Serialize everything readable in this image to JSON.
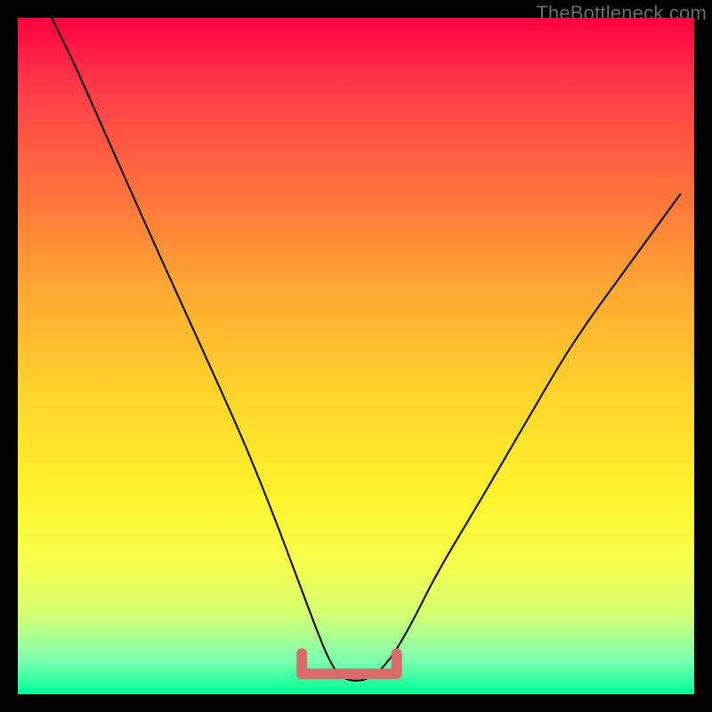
{
  "watermark": "TheBottleneck.com",
  "chart_data": {
    "type": "line",
    "title": "",
    "xlabel": "",
    "ylabel": "",
    "xlim": [
      0,
      100
    ],
    "ylim": [
      0,
      100
    ],
    "series": [
      {
        "name": "bottleneck-curve",
        "x": [
          5,
          8,
          12,
          16,
          20,
          25,
          30,
          34,
          38,
          41,
          44,
          46,
          48,
          52,
          55,
          58,
          62,
          68,
          75,
          82,
          90,
          98
        ],
        "values": [
          100,
          94,
          85,
          76,
          67,
          56,
          45,
          36,
          26,
          18,
          10,
          5,
          2,
          2,
          5,
          10,
          18,
          28,
          40,
          52,
          63,
          74
        ]
      }
    ],
    "highlight": {
      "name": "optimal-range-bracket",
      "x_start": 42,
      "x_end": 56,
      "y": 3,
      "arm_height": 3,
      "color": "#d96b6b"
    },
    "background_gradient": {
      "top": "#ff0040",
      "mid": "#fff22c",
      "bottom": "#00ff99"
    }
  }
}
